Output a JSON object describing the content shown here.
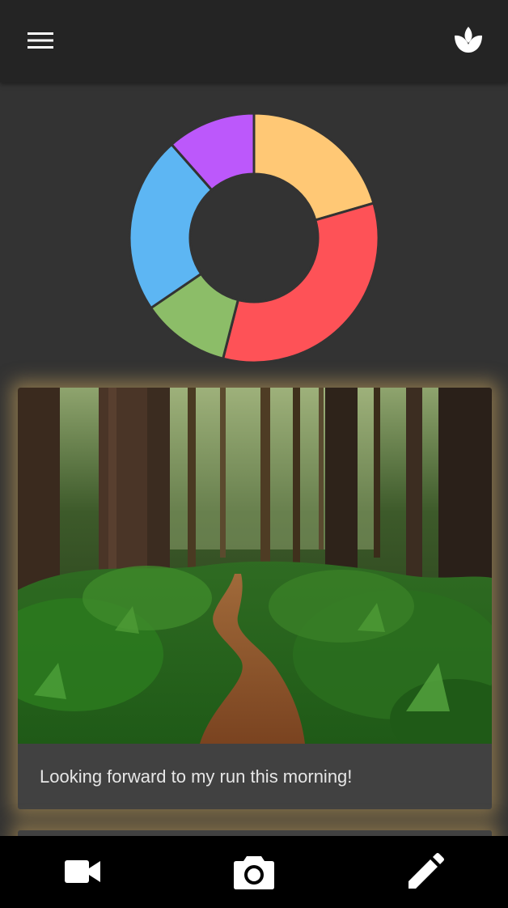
{
  "header": {
    "menu_icon": "hamburger-menu-icon",
    "right_icon": "lotus-icon"
  },
  "chart_data": {
    "type": "pie",
    "variant": "donut",
    "segments": [
      {
        "value": 20.5,
        "color": "#ffc875"
      },
      {
        "value": 33.5,
        "color": "#fe5257"
      },
      {
        "value": 11.5,
        "color": "#8cbd68"
      },
      {
        "value": 23.0,
        "color": "#5db6f3"
      },
      {
        "value": 11.5,
        "color": "#bc58fb"
      }
    ],
    "separator_color": "#333333"
  },
  "post": {
    "image_description_icon": "forest-path-photo",
    "caption": "Looking forward to my run this morning!"
  },
  "bottom_nav": {
    "video_icon": "video-camera-icon",
    "camera_icon": "camera-icon",
    "edit_icon": "pencil-icon"
  },
  "colors": {
    "background": "#333333",
    "top_bar": "#242424",
    "card": "#414141",
    "card_glow": "#c9a45c",
    "bottom_bar": "#000000"
  }
}
